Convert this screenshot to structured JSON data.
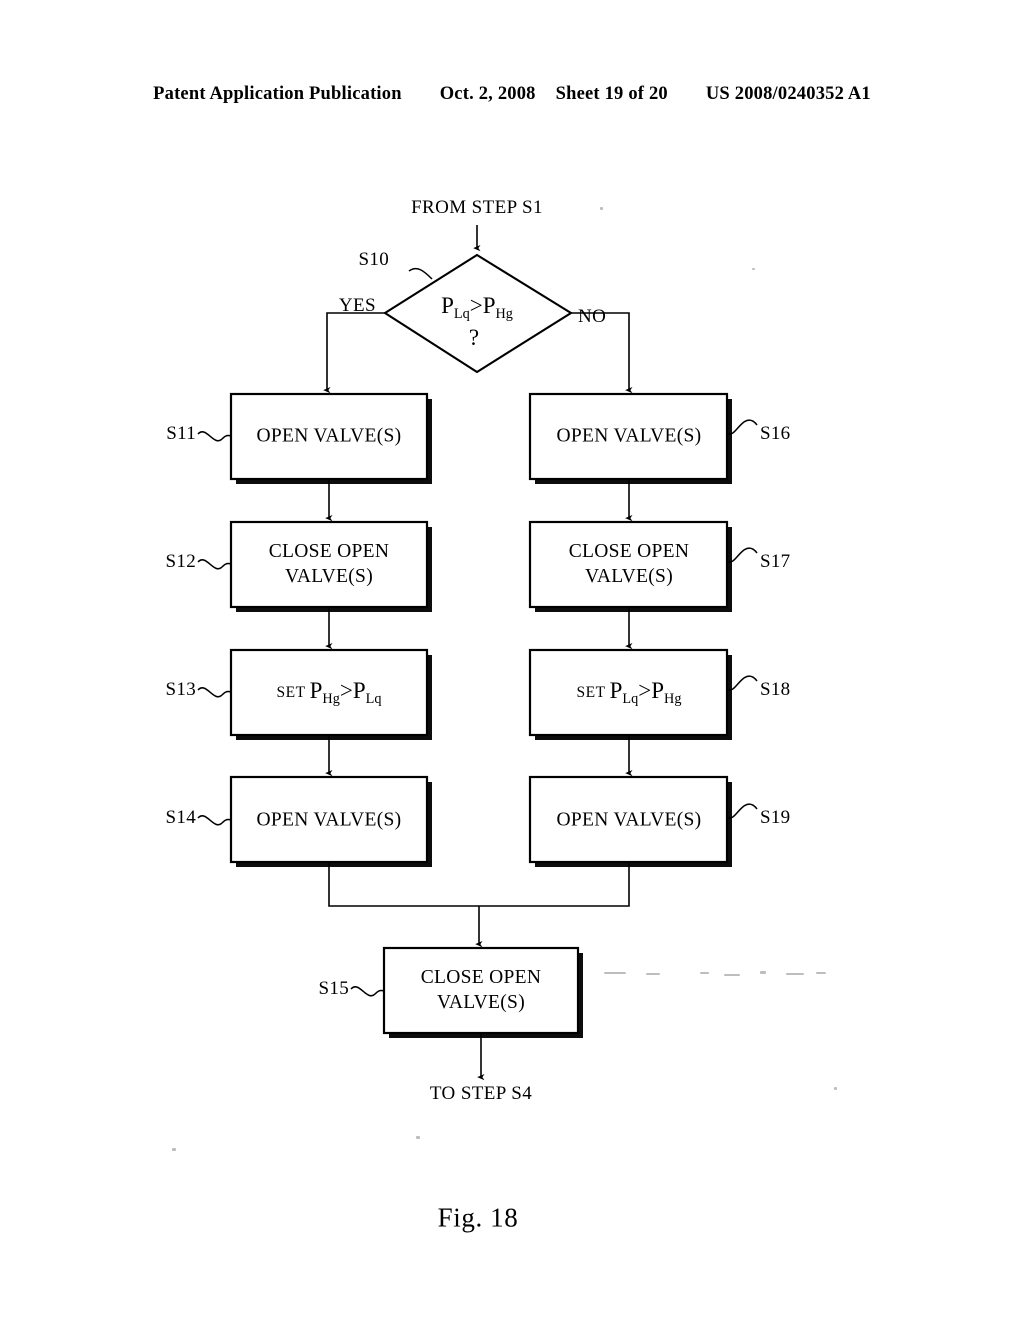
{
  "header": {
    "publication": "Patent Application Publication",
    "date": "Oct. 2, 2008",
    "sheet": "Sheet 19 of 20",
    "pub_number": "US 2008/0240352 A1"
  },
  "figure": {
    "caption": "Fig. 18",
    "entry_label": "FROM STEP S1",
    "exit_label": "TO STEP S4",
    "branch_yes": "YES",
    "branch_no": "NO",
    "decision": {
      "step_id": "S10",
      "expression_lhs": "P",
      "expression_lhs_sub": "Lq",
      "expression_op": ">",
      "expression_rhs": "P",
      "expression_rhs_sub": "Hg",
      "question_mark": "?",
      "text_plain": "P(Lq) > P(Hg) ?"
    },
    "steps": [
      {
        "step_id": "S11",
        "label_side": "left",
        "line1": "OPEN VALVE(S)",
        "line2": "",
        "kind": "text"
      },
      {
        "step_id": "S12",
        "label_side": "left",
        "line1": "CLOSE OPEN",
        "line2": "VALVE(S)",
        "kind": "text"
      },
      {
        "step_id": "S13",
        "label_side": "left",
        "kind": "formula",
        "prefix": "SET",
        "lhs": "P",
        "lhs_sub": "Hg",
        "op": ">",
        "rhs": "P",
        "rhs_sub": "Lq",
        "text_plain": "SET P(Hg) > P(Lq)"
      },
      {
        "step_id": "S14",
        "label_side": "left",
        "line1": "OPEN VALVE(S)",
        "line2": "",
        "kind": "text"
      },
      {
        "step_id": "S16",
        "label_side": "right",
        "line1": "OPEN VALVE(S)",
        "line2": "",
        "kind": "text"
      },
      {
        "step_id": "S17",
        "label_side": "right",
        "line1": "CLOSE OPEN",
        "line2": "VALVE(S)",
        "kind": "text"
      },
      {
        "step_id": "S18",
        "label_side": "right",
        "kind": "formula",
        "prefix": "SET",
        "lhs": "P",
        "lhs_sub": "Lq",
        "op": ">",
        "rhs": "P",
        "rhs_sub": "Hg",
        "text_plain": "SET P(Lq) > P(Hg)"
      },
      {
        "step_id": "S19",
        "label_side": "right",
        "line1": "OPEN VALVE(S)",
        "line2": "",
        "kind": "text"
      },
      {
        "step_id": "S15",
        "label_side": "left",
        "line1": "CLOSE OPEN",
        "line2": "VALVE(S)",
        "kind": "text"
      }
    ]
  },
  "colors": {
    "ink": "#000000",
    "paper": "#ffffff",
    "shadow": "#101010"
  }
}
